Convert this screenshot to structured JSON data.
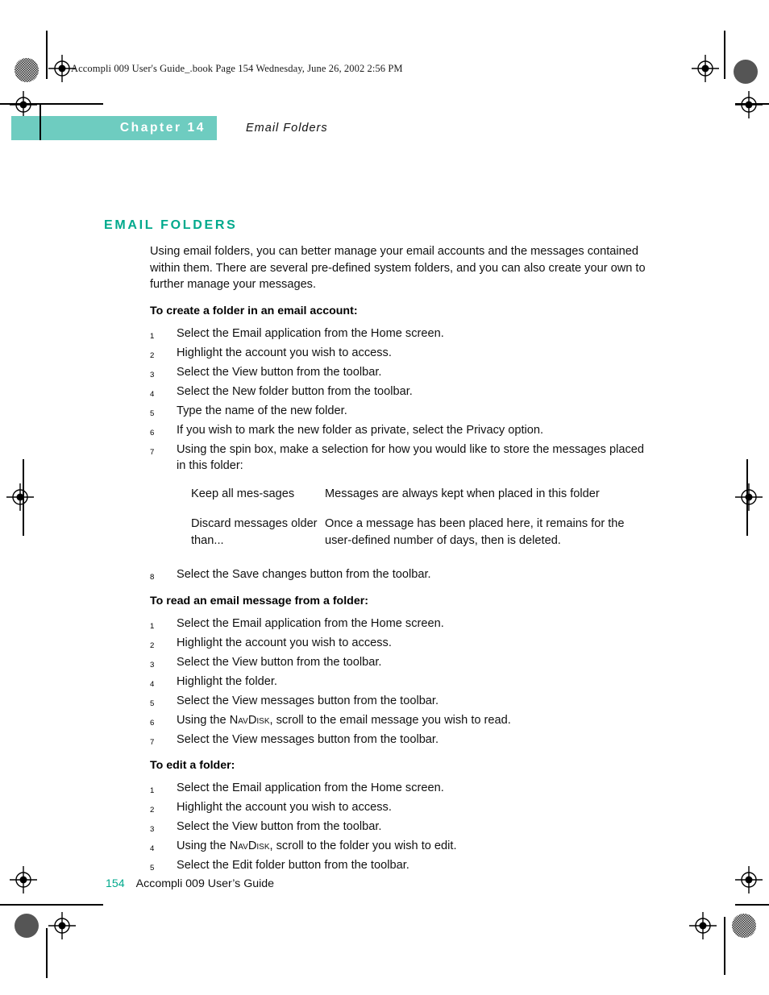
{
  "print_stamp": "Accompli 009 User's Guide_.book  Page 154  Wednesday, June 26, 2002  2:56 PM",
  "header": {
    "chapter_label": "Chapter 14",
    "running_head": "Email Folders",
    "band_color": "#6ECCC0"
  },
  "section": {
    "title": "EMAIL FOLDERS",
    "title_color": "#00A98C",
    "intro": "Using email folders, you can better manage your email accounts and the messages contained within them. There are several pre-defined system folders, and you can also create your own to further manage your messages."
  },
  "procedures": [
    {
      "heading": "To create a folder in an email account:",
      "steps_before_table": [
        {
          "num": "1",
          "text": "Select the Email application from the Home screen."
        },
        {
          "num": "2",
          "text": "Highlight the account you wish to access."
        },
        {
          "num": "3",
          "text": "Select the View button from the toolbar."
        },
        {
          "num": "4",
          "text": "Select the New folder button from the toolbar."
        },
        {
          "num": "5",
          "text": "Type the name of the new folder."
        },
        {
          "num": "6",
          "text": "If you wish to mark the new folder as private, select the Privacy option."
        },
        {
          "num": "7",
          "text": "Using the spin box, make a selection for how you would like to store the messages placed in this folder:"
        }
      ],
      "table": {
        "rows": [
          {
            "term": "Keep all mes-sages",
            "definition": "Messages are always kept when placed in this folder"
          },
          {
            "term": "Discard messages older than...",
            "definition": "Once a message has been placed here, it remains for the user-defined number of days, then is deleted."
          }
        ]
      },
      "steps_after_table": [
        {
          "num": "8",
          "text": "Select the Save changes button from the toolbar."
        }
      ]
    },
    {
      "heading": "To read an email message from a folder:",
      "steps": [
        {
          "num": "1",
          "text": "Select the Email application from the Home screen."
        },
        {
          "num": "2",
          "text": "Highlight the account you wish to access."
        },
        {
          "num": "3",
          "text": "Select the View button from the toolbar."
        },
        {
          "num": "4",
          "text": "Highlight the folder."
        },
        {
          "num": "5",
          "text": "Select the View messages button from the toolbar."
        },
        {
          "num": "6",
          "text_before": "Using the ",
          "smallcaps": "NavDisk",
          "text_after": ", scroll to the email message you wish to read."
        },
        {
          "num": "7",
          "text": "Select the View messages button from the toolbar."
        }
      ]
    },
    {
      "heading": "To edit a folder:",
      "steps": [
        {
          "num": "1",
          "text": "Select the Email application from the Home screen."
        },
        {
          "num": "2",
          "text": "Highlight the account you wish to access."
        },
        {
          "num": "3",
          "text": "Select the View button from the toolbar."
        },
        {
          "num": "4",
          "text_before": "Using the ",
          "smallcaps": "NavDisk",
          "text_after": ", scroll to the folder you wish to edit."
        },
        {
          "num": "5",
          "text": "Select the Edit folder button from the toolbar."
        }
      ]
    }
  ],
  "footer": {
    "page_number": "154",
    "book_title": "Accompli 009 User’s Guide",
    "page_number_color": "#00A98C"
  }
}
